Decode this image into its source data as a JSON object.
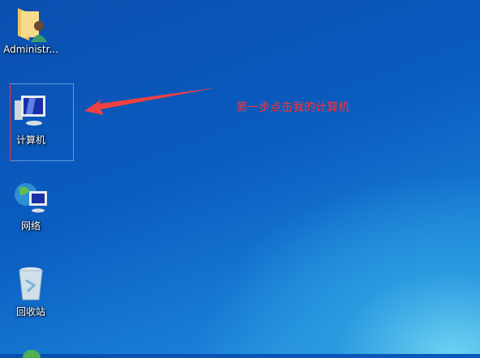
{
  "desktop": {
    "icons": [
      {
        "label": "Administr..."
      },
      {
        "label": "计算机"
      },
      {
        "label": "网络"
      },
      {
        "label": "回收站"
      }
    ]
  },
  "annotation": {
    "text": "第一步点击我的计算机",
    "color": "#ff3030"
  }
}
